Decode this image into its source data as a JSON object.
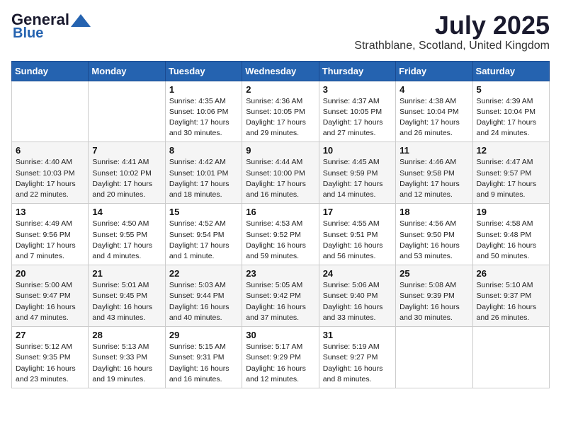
{
  "header": {
    "logo_line1": "General",
    "logo_line2": "Blue",
    "month_title": "July 2025",
    "location": "Strathblane, Scotland, United Kingdom"
  },
  "days_of_week": [
    "Sunday",
    "Monday",
    "Tuesday",
    "Wednesday",
    "Thursday",
    "Friday",
    "Saturday"
  ],
  "weeks": [
    [
      {
        "day": "",
        "detail": ""
      },
      {
        "day": "",
        "detail": ""
      },
      {
        "day": "1",
        "detail": "Sunrise: 4:35 AM\nSunset: 10:06 PM\nDaylight: 17 hours and 30 minutes."
      },
      {
        "day": "2",
        "detail": "Sunrise: 4:36 AM\nSunset: 10:05 PM\nDaylight: 17 hours and 29 minutes."
      },
      {
        "day": "3",
        "detail": "Sunrise: 4:37 AM\nSunset: 10:05 PM\nDaylight: 17 hours and 27 minutes."
      },
      {
        "day": "4",
        "detail": "Sunrise: 4:38 AM\nSunset: 10:04 PM\nDaylight: 17 hours and 26 minutes."
      },
      {
        "day": "5",
        "detail": "Sunrise: 4:39 AM\nSunset: 10:04 PM\nDaylight: 17 hours and 24 minutes."
      }
    ],
    [
      {
        "day": "6",
        "detail": "Sunrise: 4:40 AM\nSunset: 10:03 PM\nDaylight: 17 hours and 22 minutes."
      },
      {
        "day": "7",
        "detail": "Sunrise: 4:41 AM\nSunset: 10:02 PM\nDaylight: 17 hours and 20 minutes."
      },
      {
        "day": "8",
        "detail": "Sunrise: 4:42 AM\nSunset: 10:01 PM\nDaylight: 17 hours and 18 minutes."
      },
      {
        "day": "9",
        "detail": "Sunrise: 4:44 AM\nSunset: 10:00 PM\nDaylight: 17 hours and 16 minutes."
      },
      {
        "day": "10",
        "detail": "Sunrise: 4:45 AM\nSunset: 9:59 PM\nDaylight: 17 hours and 14 minutes."
      },
      {
        "day": "11",
        "detail": "Sunrise: 4:46 AM\nSunset: 9:58 PM\nDaylight: 17 hours and 12 minutes."
      },
      {
        "day": "12",
        "detail": "Sunrise: 4:47 AM\nSunset: 9:57 PM\nDaylight: 17 hours and 9 minutes."
      }
    ],
    [
      {
        "day": "13",
        "detail": "Sunrise: 4:49 AM\nSunset: 9:56 PM\nDaylight: 17 hours and 7 minutes."
      },
      {
        "day": "14",
        "detail": "Sunrise: 4:50 AM\nSunset: 9:55 PM\nDaylight: 17 hours and 4 minutes."
      },
      {
        "day": "15",
        "detail": "Sunrise: 4:52 AM\nSunset: 9:54 PM\nDaylight: 17 hours and 1 minute."
      },
      {
        "day": "16",
        "detail": "Sunrise: 4:53 AM\nSunset: 9:52 PM\nDaylight: 16 hours and 59 minutes."
      },
      {
        "day": "17",
        "detail": "Sunrise: 4:55 AM\nSunset: 9:51 PM\nDaylight: 16 hours and 56 minutes."
      },
      {
        "day": "18",
        "detail": "Sunrise: 4:56 AM\nSunset: 9:50 PM\nDaylight: 16 hours and 53 minutes."
      },
      {
        "day": "19",
        "detail": "Sunrise: 4:58 AM\nSunset: 9:48 PM\nDaylight: 16 hours and 50 minutes."
      }
    ],
    [
      {
        "day": "20",
        "detail": "Sunrise: 5:00 AM\nSunset: 9:47 PM\nDaylight: 16 hours and 47 minutes."
      },
      {
        "day": "21",
        "detail": "Sunrise: 5:01 AM\nSunset: 9:45 PM\nDaylight: 16 hours and 43 minutes."
      },
      {
        "day": "22",
        "detail": "Sunrise: 5:03 AM\nSunset: 9:44 PM\nDaylight: 16 hours and 40 minutes."
      },
      {
        "day": "23",
        "detail": "Sunrise: 5:05 AM\nSunset: 9:42 PM\nDaylight: 16 hours and 37 minutes."
      },
      {
        "day": "24",
        "detail": "Sunrise: 5:06 AM\nSunset: 9:40 PM\nDaylight: 16 hours and 33 minutes."
      },
      {
        "day": "25",
        "detail": "Sunrise: 5:08 AM\nSunset: 9:39 PM\nDaylight: 16 hours and 30 minutes."
      },
      {
        "day": "26",
        "detail": "Sunrise: 5:10 AM\nSunset: 9:37 PM\nDaylight: 16 hours and 26 minutes."
      }
    ],
    [
      {
        "day": "27",
        "detail": "Sunrise: 5:12 AM\nSunset: 9:35 PM\nDaylight: 16 hours and 23 minutes."
      },
      {
        "day": "28",
        "detail": "Sunrise: 5:13 AM\nSunset: 9:33 PM\nDaylight: 16 hours and 19 minutes."
      },
      {
        "day": "29",
        "detail": "Sunrise: 5:15 AM\nSunset: 9:31 PM\nDaylight: 16 hours and 16 minutes."
      },
      {
        "day": "30",
        "detail": "Sunrise: 5:17 AM\nSunset: 9:29 PM\nDaylight: 16 hours and 12 minutes."
      },
      {
        "day": "31",
        "detail": "Sunrise: 5:19 AM\nSunset: 9:27 PM\nDaylight: 16 hours and 8 minutes."
      },
      {
        "day": "",
        "detail": ""
      },
      {
        "day": "",
        "detail": ""
      }
    ]
  ]
}
